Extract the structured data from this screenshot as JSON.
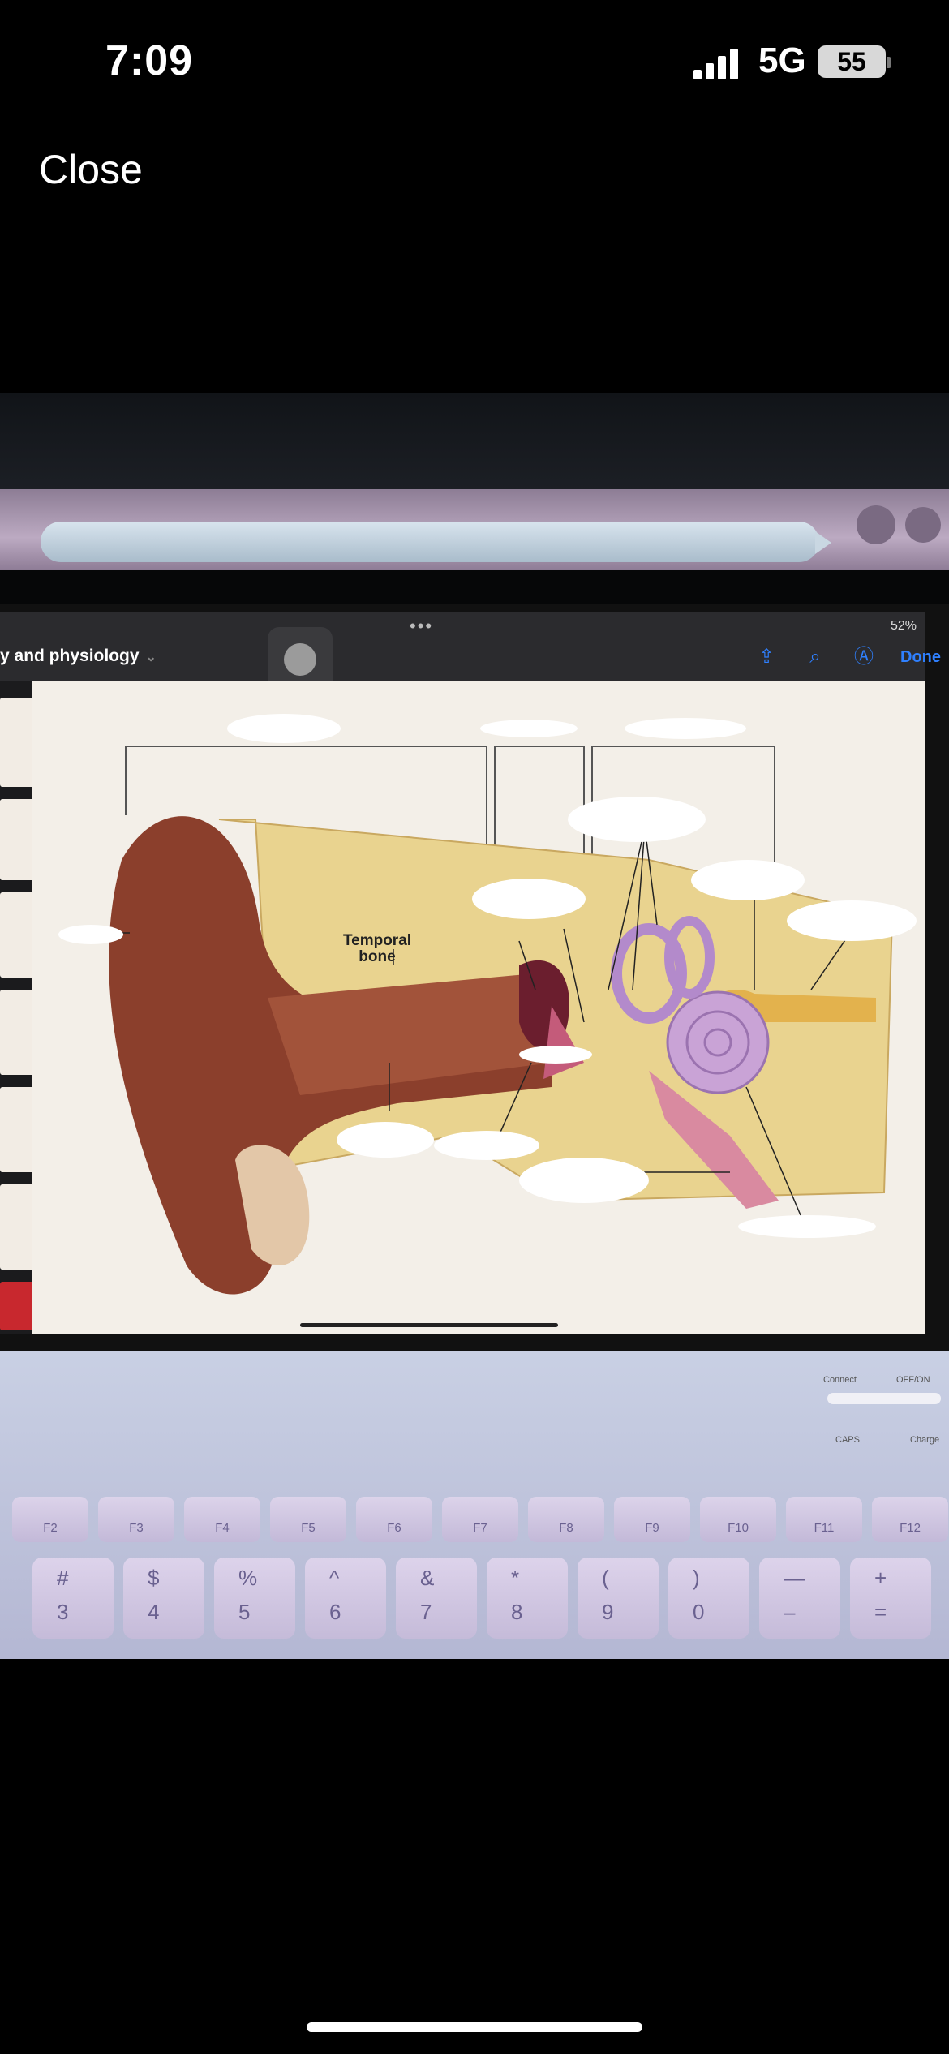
{
  "status_bar": {
    "time": "7:09",
    "network": "5G",
    "battery": "55"
  },
  "viewer": {
    "close_label": "Close"
  },
  "ipad": {
    "status": "52%",
    "doc_title": "y and physiology",
    "done_label": "Done",
    "diagram_label": "Temporal bone"
  },
  "keyboard": {
    "function_keys": [
      "F2",
      "F3",
      "F4",
      "F5",
      "F6",
      "F7",
      "F8",
      "F9",
      "F10",
      "F11",
      "F12"
    ],
    "number_keys": [
      {
        "top": "#",
        "bottom": "3"
      },
      {
        "top": "$",
        "bottom": "4"
      },
      {
        "top": "%",
        "bottom": "5"
      },
      {
        "top": "^",
        "bottom": "6"
      },
      {
        "top": "&",
        "bottom": "7"
      },
      {
        "top": "*",
        "bottom": "8"
      },
      {
        "top": "(",
        "bottom": "9"
      },
      {
        "top": ")",
        "bottom": "0"
      },
      {
        "top": "—",
        "bottom": "–"
      },
      {
        "top": "+",
        "bottom": "="
      }
    ],
    "switch_labels": {
      "connect": "Connect",
      "onoff": "OFF/ON",
      "caps": "CAPS",
      "charge": "Charge"
    }
  }
}
